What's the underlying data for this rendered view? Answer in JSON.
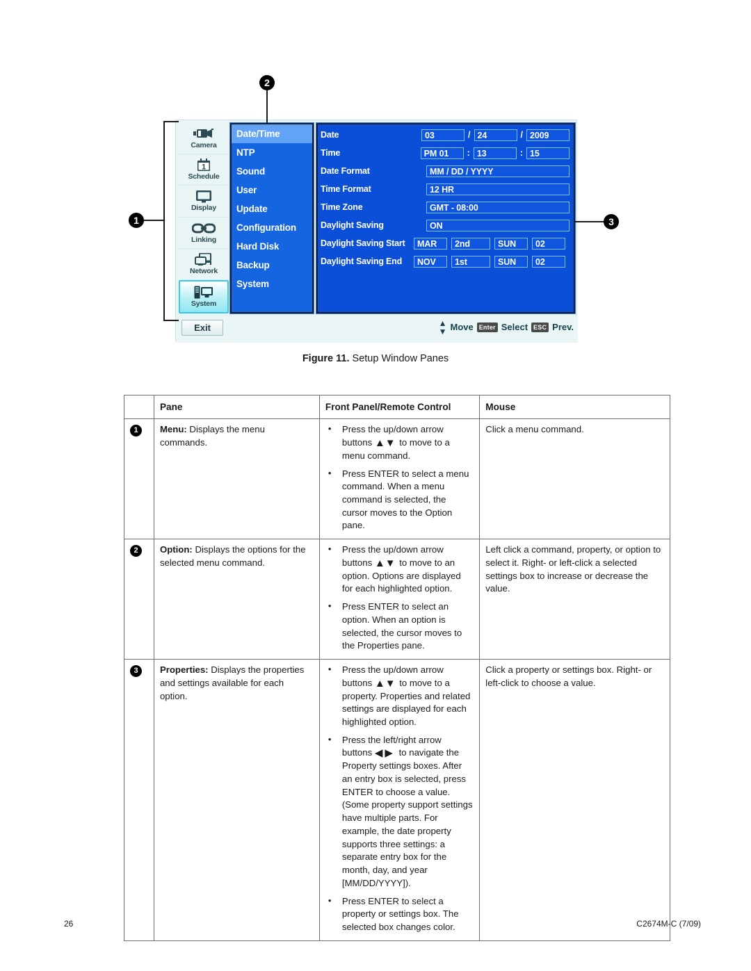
{
  "figure": {
    "caption_label": "Figure 11.",
    "caption_text": "Setup Window Panes",
    "callouts": {
      "one": "1",
      "two": "2",
      "three": "3"
    }
  },
  "dvr": {
    "menu_pane": {
      "items": [
        {
          "label": "Camera",
          "icon": "camera-icon",
          "selected": false
        },
        {
          "label": "Schedule",
          "icon": "calendar-icon",
          "selected": false
        },
        {
          "label": "Display",
          "icon": "monitor-icon",
          "selected": false
        },
        {
          "label": "Linking",
          "icon": "chain-link-icon",
          "selected": false
        },
        {
          "label": "Network",
          "icon": "network-icon",
          "selected": false
        },
        {
          "label": "System",
          "icon": "system-tower-icon",
          "selected": true
        }
      ]
    },
    "option_pane": {
      "items": [
        {
          "label": "Date/Time",
          "selected": true
        },
        {
          "label": "NTP",
          "selected": false
        },
        {
          "label": "Sound",
          "selected": false
        },
        {
          "label": "User",
          "selected": false
        },
        {
          "label": "Update",
          "selected": false
        },
        {
          "label": "Configuration",
          "selected": false
        },
        {
          "label": "Hard Disk",
          "selected": false
        },
        {
          "label": "Backup",
          "selected": false
        },
        {
          "label": "System",
          "selected": false
        }
      ]
    },
    "properties_pane": {
      "rows": [
        {
          "label": "Date",
          "fields": [
            "03",
            "24",
            "2009"
          ],
          "separators": [
            "/",
            "/"
          ]
        },
        {
          "label": "Time",
          "fields": [
            "PM  01",
            "13",
            "15"
          ],
          "separators": [
            ":",
            ":"
          ]
        },
        {
          "label": "Date Format",
          "fields": [
            "MM / DD / YYYY"
          ]
        },
        {
          "label": "Time Format",
          "fields": [
            "12 HR"
          ]
        },
        {
          "label": "Time Zone",
          "fields": [
            "GMT - 08:00"
          ]
        },
        {
          "label": "Daylight Saving",
          "fields": [
            "ON"
          ]
        },
        {
          "label": "Daylight Saving Start",
          "fields": [
            "MAR",
            "2nd",
            "SUN",
            "02"
          ]
        },
        {
          "label": "Daylight Saving End",
          "fields": [
            "NOV",
            "1st",
            "SUN",
            "02"
          ]
        }
      ]
    },
    "status_bar": {
      "exit_label": "Exit",
      "move_label": "Move",
      "enter_key": "Enter",
      "select_label": "Select",
      "esc_key": "ESC",
      "prev_label": "Prev."
    },
    "colors": {
      "pane_blue": "#0b4fd8",
      "option_blue": "#1565e0",
      "option_highlight": "#63a3f7",
      "window_bg": "#e8f5f4",
      "selected_icon": "#8fe6f2"
    }
  },
  "table": {
    "headers": {
      "num": "",
      "pane": "Pane",
      "front": "Front Panel/Remote Control",
      "mouse": "Mouse"
    },
    "rows": [
      {
        "num": "1",
        "pane_term": "Menu:",
        "pane_text": " Displays the menu commands.",
        "front_bullets": [
          {
            "pre": "Press the up/down arrow buttons ",
            "arrows": "updown",
            "post": " to move to a menu command."
          },
          {
            "pre": "Press ENTER to select a menu command. When a menu command is selected, the cursor moves to the Option pane.",
            "arrows": "",
            "post": ""
          }
        ],
        "mouse_text": "Click a menu command."
      },
      {
        "num": "2",
        "pane_term": "Option:",
        "pane_text": " Displays the options for the selected menu command.",
        "front_bullets": [
          {
            "pre": "Press the up/down arrow buttons ",
            "arrows": "updown",
            "post": " to move to an option. Options are displayed for each highlighted option."
          },
          {
            "pre": "Press ENTER to select an option. When an option is selected, the cursor moves to the Properties pane.",
            "arrows": "",
            "post": ""
          }
        ],
        "mouse_text": "Left click a command, property, or option to select it. Right- or left-click a selected settings box to increase or decrease the value."
      },
      {
        "num": "3",
        "pane_term": "Properties:",
        "pane_text": " Displays the properties and settings available for each option.",
        "front_bullets": [
          {
            "pre": "Press the up/down arrow buttons ",
            "arrows": "updown",
            "post": " to move to a property. Properties and related settings are displayed for each highlighted option."
          },
          {
            "pre": "Press the left/right arrow buttons ",
            "arrows": "leftright",
            "post": " to navigate the Property settings boxes. After an entry box is selected, press ENTER to choose a value. (Some property support settings have multiple parts. For example, the date property supports three settings: a separate entry box for the month, day, and year [MM/DD/YYYY])."
          },
          {
            "pre": "Press ENTER to select a property or settings box. The selected box changes color.",
            "arrows": "",
            "post": ""
          }
        ],
        "mouse_text": "Click a property or settings box. Right- or left-click to choose a value."
      }
    ]
  },
  "footer": {
    "page_number": "26",
    "document_code": "C2674M-C (7/09)"
  }
}
